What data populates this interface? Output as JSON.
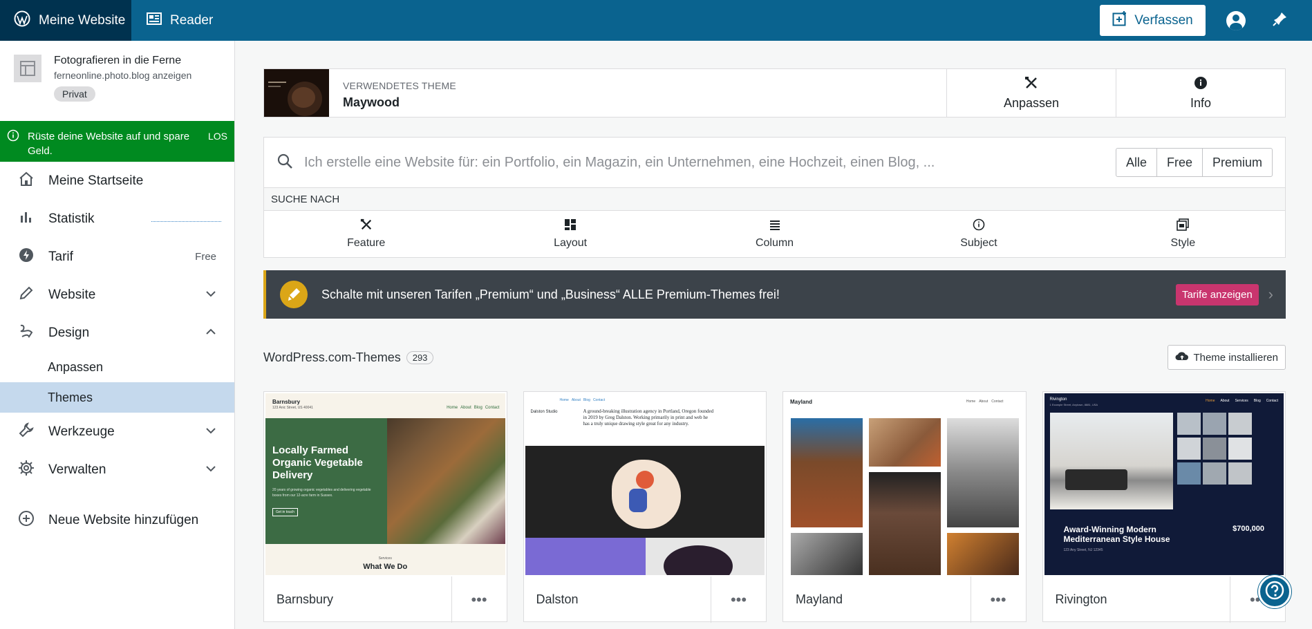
{
  "topbar": {
    "site_label": "Meine Website",
    "reader_label": "Reader",
    "compose_label": "Verfassen"
  },
  "sidebar": {
    "site_title": "Fotografieren in die Ferne",
    "site_url": "ferneonline.photo.blog anzeigen",
    "private_badge": "Privat",
    "upgrade_text": "Rüste deine Website auf und spare Geld.",
    "upgrade_go": "LOS",
    "items": [
      {
        "label": "Meine Startseite"
      },
      {
        "label": "Statistik"
      },
      {
        "label": "Tarif",
        "right": "Free"
      },
      {
        "label": "Website"
      },
      {
        "label": "Design"
      },
      {
        "label": "Werkzeuge"
      },
      {
        "label": "Verwalten"
      },
      {
        "label": "Neue Website hinzufügen"
      }
    ],
    "design_sub": [
      "Anpassen",
      "Themes"
    ]
  },
  "current_theme": {
    "label": "VERWENDETES THEME",
    "name": "Maywood",
    "customize_label": "Anpassen",
    "info_label": "Info"
  },
  "search": {
    "placeholder": "Ich erstelle eine Website für: ein Portfolio, ein Magazin, ein Unternehmen, eine Hochzeit, einen Blog, ...",
    "segments": [
      "Alle",
      "Free",
      "Premium"
    ],
    "search_for_label": "SUCHE NACH",
    "filters": [
      "Feature",
      "Layout",
      "Column",
      "Subject",
      "Style"
    ]
  },
  "promo": {
    "text": "Schalte mit unseren Tarifen „Premium“ und „Business“ ALLE Premium-Themes frei!",
    "button": "Tarife anzeigen"
  },
  "themes": {
    "title": "WordPress.com-Themes",
    "count": "293",
    "install_label": "Theme installieren",
    "cards": [
      {
        "name": "Barnsbury",
        "shot_brand": "Barnsbury",
        "shot_address": "123 Anic Street, US 40041",
        "shot_nav": [
          "Home",
          "About",
          "Blog",
          "Contact"
        ],
        "shot_heading": "Locally Farmed Organic Vegetable Delivery",
        "shot_text": "20 years of growing organic vegetables and delivering vegetable boxes from our 12-acre farm in Sussex.",
        "shot_button": "Get in touch",
        "shot_services": "Services",
        "shot_what": "What We Do"
      },
      {
        "name": "Dalston",
        "shot_nav": [
          "Home",
          "About",
          "Blog",
          "Contact"
        ],
        "shot_brand": "Dalston Studio",
        "shot_text": "A ground-breaking illustration agency in Portland, Oregon founded in 2019 by Greg Dalston. Working primarily in print and web he has a truly unique drawing style great for any industry."
      },
      {
        "name": "Mayland",
        "shot_brand": "Mayland",
        "shot_nav": [
          "Home",
          "About",
          "Contact"
        ]
      },
      {
        "name": "Rivington",
        "shot_brand": "Rivington",
        "shot_address": "1 Example Street, Anytown, 8881, USA",
        "shot_nav": [
          "Home",
          "About",
          "Services",
          "Blog",
          "Contact"
        ],
        "shot_heading": "Award-Winning Modern Mediterranean Style House",
        "shot_price": "$700,000",
        "shot_location": "123 Any Street, NJ 12345"
      }
    ]
  },
  "colors": {
    "topbar": "#0a638f",
    "topbar_dark": "#00324f",
    "upgrade_green": "#008a20",
    "promo_dark": "#3c434a",
    "promo_accent": "#dba617",
    "promo_button": "#c9356e",
    "active_sub": "#c5d9ed"
  }
}
